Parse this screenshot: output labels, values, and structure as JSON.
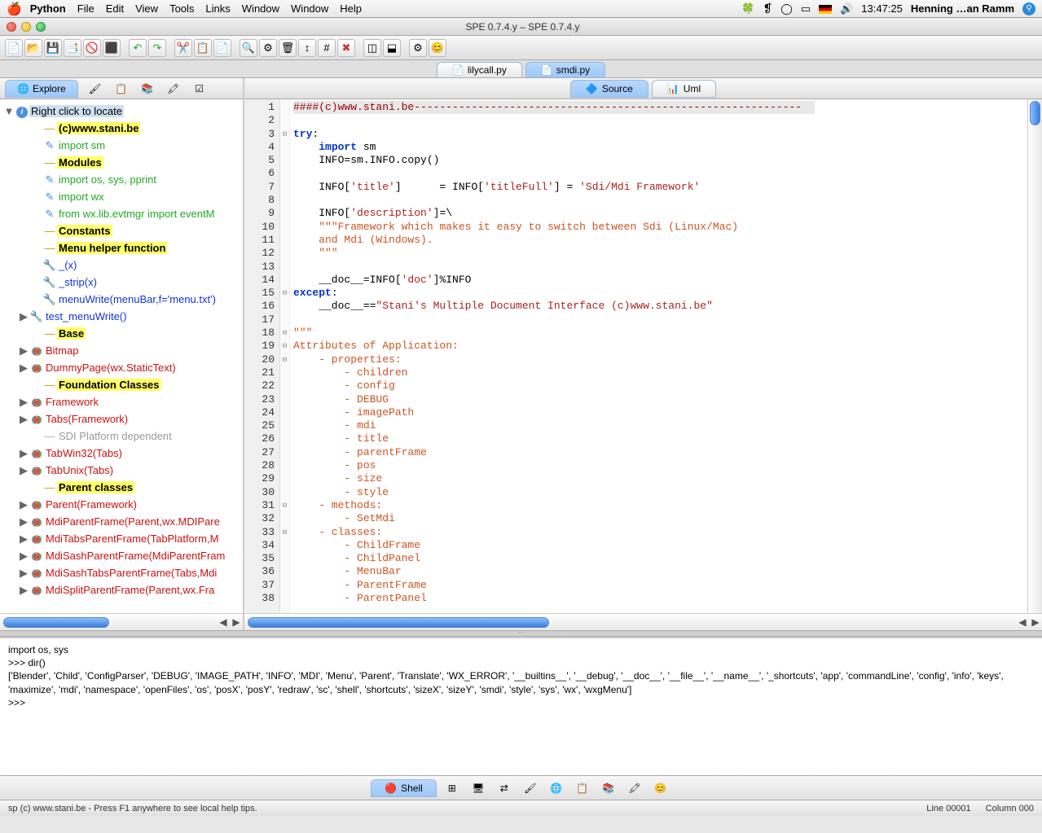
{
  "menubar": {
    "app": "Python",
    "items": [
      "File",
      "Edit",
      "View",
      "Tools",
      "Links",
      "Window",
      "Window",
      "Help"
    ],
    "clock": "13:47:25",
    "user": "Henning …an Ramm"
  },
  "window": {
    "title": "SPE 0.7.4.y – SPE 0.7.4.y"
  },
  "file_tabs": {
    "inactive": "lilycall.py",
    "active": "smdi.py"
  },
  "sidebar": {
    "tab": "Explore",
    "root": "Right click to locate",
    "items": [
      {
        "t": "hl",
        "txt": "(c)www.stani.be",
        "indent": 2,
        "arrow": ""
      },
      {
        "t": "green",
        "txt": "import sm",
        "indent": 2,
        "arrow": "",
        "icon": "import"
      },
      {
        "t": "hl",
        "txt": "Modules",
        "indent": 2,
        "arrow": ""
      },
      {
        "t": "green",
        "txt": "import  os, sys, pprint",
        "indent": 2,
        "arrow": "",
        "icon": "import"
      },
      {
        "t": "green",
        "txt": "import  wx",
        "indent": 2,
        "arrow": "",
        "icon": "import"
      },
      {
        "t": "green",
        "txt": "from    wx.lib.evtmgr import eventM",
        "indent": 2,
        "arrow": "",
        "icon": "import"
      },
      {
        "t": "hl",
        "txt": "Constants",
        "indent": 2,
        "arrow": ""
      },
      {
        "t": "hl",
        "txt": "Menu helper function",
        "indent": 2,
        "arrow": ""
      },
      {
        "t": "blue",
        "txt": "_(x)",
        "indent": 2,
        "arrow": "",
        "icon": "wrench"
      },
      {
        "t": "blue",
        "txt": "_strip(x)",
        "indent": 2,
        "arrow": "",
        "icon": "wrench"
      },
      {
        "t": "blue",
        "txt": "menuWrite(menuBar,f='menu.txt')",
        "indent": 2,
        "arrow": "",
        "icon": "wrench"
      },
      {
        "t": "blue",
        "txt": "test_menuWrite()",
        "indent": 1,
        "arrow": "▶",
        "icon": "wrench"
      },
      {
        "t": "hl",
        "txt": "Base",
        "indent": 2,
        "arrow": ""
      },
      {
        "t": "red",
        "txt": "Bitmap",
        "indent": 1,
        "arrow": "▶",
        "icon": "class"
      },
      {
        "t": "red",
        "txt": "DummyPage(wx.StaticText)",
        "indent": 1,
        "arrow": "▶",
        "icon": "class"
      },
      {
        "t": "hl",
        "txt": "Foundation Classes",
        "indent": 2,
        "arrow": ""
      },
      {
        "t": "red",
        "txt": "Framework",
        "indent": 1,
        "arrow": "▶",
        "icon": "class"
      },
      {
        "t": "red",
        "txt": "Tabs(Framework)",
        "indent": 1,
        "arrow": "▶",
        "icon": "class"
      },
      {
        "t": "gray",
        "txt": "SDI Platform dependent",
        "indent": 2,
        "arrow": ""
      },
      {
        "t": "red",
        "txt": "TabWin32(Tabs)",
        "indent": 1,
        "arrow": "▶",
        "icon": "class"
      },
      {
        "t": "red",
        "txt": "TabUnix(Tabs)",
        "indent": 1,
        "arrow": "▶",
        "icon": "class"
      },
      {
        "t": "hl",
        "txt": "Parent classes",
        "indent": 2,
        "arrow": ""
      },
      {
        "t": "red",
        "txt": "Parent(Framework)",
        "indent": 1,
        "arrow": "▶",
        "icon": "class"
      },
      {
        "t": "red",
        "txt": "MdiParentFrame(Parent,wx.MDIPare",
        "indent": 1,
        "arrow": "▶",
        "icon": "class"
      },
      {
        "t": "red",
        "txt": "MdiTabsParentFrame(TabPlatform,M",
        "indent": 1,
        "arrow": "▶",
        "icon": "class"
      },
      {
        "t": "red",
        "txt": "MdiSashParentFrame(MdiParentFram",
        "indent": 1,
        "arrow": "▶",
        "icon": "class"
      },
      {
        "t": "red",
        "txt": "MdiSashTabsParentFrame(Tabs,Mdi",
        "indent": 1,
        "arrow": "▶",
        "icon": "class"
      },
      {
        "t": "red",
        "txt": "MdiSplitParentFrame(Parent,wx.Fra",
        "indent": 1,
        "arrow": "▶",
        "icon": "class"
      }
    ]
  },
  "editor_tabs": {
    "active": "Source",
    "inactive": "Uml"
  },
  "code_lines": [
    {
      "n": 1,
      "fold": "",
      "html": "<span class='line1-bg'><span class='maroon'>####(c)www.stani.be</span><span class='darkred'>-------------------------------------------------------------</span></span>"
    },
    {
      "n": 2,
      "fold": "",
      "html": ""
    },
    {
      "n": 3,
      "fold": "⊟",
      "html": "<span class='kw'>try</span>:"
    },
    {
      "n": 4,
      "fold": "",
      "html": "    <span class='kw'>import</span> sm"
    },
    {
      "n": 5,
      "fold": "",
      "html": "    INFO=sm.INFO.copy()"
    },
    {
      "n": 6,
      "fold": "",
      "html": ""
    },
    {
      "n": 7,
      "fold": "",
      "html": "    INFO[<span class='str2'>'title'</span>]      = INFO[<span class='str2'>'titleFull'</span>] = <span class='str2'>'Sdi/Mdi Framework'</span>"
    },
    {
      "n": 8,
      "fold": "",
      "html": ""
    },
    {
      "n": 9,
      "fold": "",
      "html": "    INFO[<span class='str2'>'description'</span>]=\\"
    },
    {
      "n": 10,
      "fold": "",
      "html": "    <span class='str'>\"\"\"Framework which makes it easy to switch between Sdi (Linux/Mac)</span>"
    },
    {
      "n": 11,
      "fold": "",
      "html": "<span class='str'>    and Mdi (Windows).</span>"
    },
    {
      "n": 12,
      "fold": "",
      "html": "<span class='str'>    \"\"\"</span>"
    },
    {
      "n": 13,
      "fold": "",
      "html": ""
    },
    {
      "n": 14,
      "fold": "",
      "html": "    __doc__=INFO[<span class='str2'>'doc'</span>]%INFO"
    },
    {
      "n": 15,
      "fold": "⊟",
      "html": "<span class='kw'>except</span>:"
    },
    {
      "n": 16,
      "fold": "",
      "html": "    __doc__==<span class='str2'>\"Stani's Multiple Document Interface (c)www.stani.be\"</span>"
    },
    {
      "n": 17,
      "fold": "",
      "html": ""
    },
    {
      "n": 18,
      "fold": "⊟",
      "html": "<span class='str'>\"\"\"</span>"
    },
    {
      "n": 19,
      "fold": "⊟",
      "html": "<span class='str'>Attributes of Application:</span>"
    },
    {
      "n": 20,
      "fold": "⊟",
      "html": "<span class='str'>    - properties:</span>"
    },
    {
      "n": 21,
      "fold": "",
      "html": "<span class='str'>        - children</span>"
    },
    {
      "n": 22,
      "fold": "",
      "html": "<span class='str'>        - config</span>"
    },
    {
      "n": 23,
      "fold": "",
      "html": "<span class='str'>        - DEBUG</span>"
    },
    {
      "n": 24,
      "fold": "",
      "html": "<span class='str'>        - imagePath</span>"
    },
    {
      "n": 25,
      "fold": "",
      "html": "<span class='str'>        - mdi</span>"
    },
    {
      "n": 26,
      "fold": "",
      "html": "<span class='str'>        - title</span>"
    },
    {
      "n": 27,
      "fold": "",
      "html": "<span class='str'>        - parentFrame</span>"
    },
    {
      "n": 28,
      "fold": "",
      "html": "<span class='str'>        - pos</span>"
    },
    {
      "n": 29,
      "fold": "",
      "html": "<span class='str'>        - size</span>"
    },
    {
      "n": 30,
      "fold": "",
      "html": "<span class='str'>        - style</span>"
    },
    {
      "n": 31,
      "fold": "⊟",
      "html": "<span class='str'>    - methods:</span>"
    },
    {
      "n": 32,
      "fold": "",
      "html": "<span class='str'>        - SetMdi</span>"
    },
    {
      "n": 33,
      "fold": "⊟",
      "html": "<span class='str'>    - classes:</span>"
    },
    {
      "n": 34,
      "fold": "",
      "html": "<span class='str'>        - ChildFrame</span>"
    },
    {
      "n": 35,
      "fold": "",
      "html": "<span class='str'>        - ChildPanel</span>"
    },
    {
      "n": 36,
      "fold": "",
      "html": "<span class='str'>        - MenuBar</span>"
    },
    {
      "n": 37,
      "fold": "",
      "html": "<span class='str'>        - ParentFrame</span>"
    },
    {
      "n": 38,
      "fold": "",
      "html": "<span class='str'>        - ParentPanel</span>"
    }
  ],
  "console_lines": [
    "import os, sys",
    ">>> dir()",
    "['Blender', 'Child', 'ConfigParser', 'DEBUG', 'IMAGE_PATH', 'INFO', 'MDI', 'Menu', 'Parent', 'Translate', 'WX_ERROR', '__builtins__', '__debug', '__doc__', '__file__', '__name__', '_shortcuts', 'app', 'commandLine', 'config', 'info', 'keys', 'maximize', 'mdi', 'namespace', 'openFiles', 'os', 'posX', 'posY', 'redraw', 'sc', 'shell', 'shortcuts', 'sizeX', 'sizeY', 'smdi', 'style', 'sys', 'wx', 'wxgMenu']",
    ">>> "
  ],
  "bottom": {
    "shell": "Shell"
  },
  "status": {
    "left": "sp  (c) www.stani.be - Press F1 anywhere to see local help tips.",
    "line": "Line 00001",
    "col": "Column 000"
  }
}
